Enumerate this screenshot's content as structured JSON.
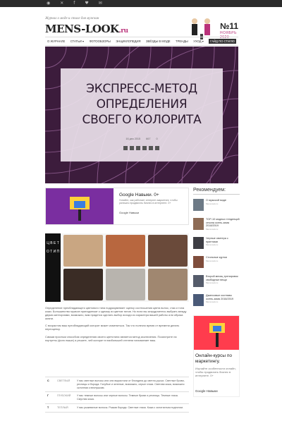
{
  "topbar": {
    "icons": [
      "rss-icon",
      "twitter-icon",
      "facebook-icon",
      "vk-icon",
      "mail-icon"
    ],
    "glyphs": [
      "◉",
      "✕",
      "f",
      "♥",
      "✉"
    ]
  },
  "header": {
    "tagline": "Журнал о моде и стиле для мужчин",
    "logo": "MENS-LOOK",
    "logo_suffix": ".ru",
    "issue_no": "№11",
    "issue_month": "НОЯБРЬ 2020"
  },
  "nav": {
    "items": [
      "О журнале",
      "Статьи ▾",
      "Фотообзоры",
      "Энциклопедия",
      "Звёзды в моде",
      "Тренды",
      "Уход ▾",
      "Гайд по стилю"
    ]
  },
  "hero": {
    "title_lines": [
      "ЭКСПРЕСС-МЕТОД",
      "ОПРЕДЕЛЕНИЯ",
      "СВОЕГО КОЛОРИТА"
    ],
    "date": "16 дек 2015",
    "views": "667",
    "comments": "0"
  },
  "ad": {
    "title": "Google Навыки. 0+",
    "desc": "Узнайте, как работает интернет-маркетинг, чтобы успешно продвигать бизнес в интернете. 0+",
    "source": "Google Навыки"
  },
  "sidebar": {
    "title": "Рекомендуем:",
    "items": [
      {
        "title": "О мужской моде",
        "meta": "Mens-look.ru"
      },
      {
        "title": "TOP-10 модных тенденций сезона осень-зима 2018/2019",
        "meta": "Mens-look.ru"
      },
      {
        "title": "Черные свитера с принтами",
        "meta": "Mens-look.ru"
      },
      {
        "title": "Стильные куртки",
        "meta": "Mens-look.ru"
      },
      {
        "title": "Второй месяц тренировок свободные вещи",
        "meta": "Mens-look.ru"
      },
      {
        "title": "Джинсовые костюмы осень-зима 2018/2019",
        "meta": "Mens-look.ru"
      }
    ],
    "ad_title": "Онлайн-курсы по маркетингу.",
    "ad_sub": "Изучайте особенности онлайн, чтобы продвигать бизнес в интернете. 0+",
    "ad_src": "Google Навыки"
  },
  "collage": {
    "side_text": "Ц В Е Т О Т И П"
  },
  "body": {
    "paragraphs": [
      "Определение преобладающего цветового типа подразумевает оценку соотношения цвета волос, глаз и тона кожи. Большинство мужчин принадлежат к одному из цветов типов. Но если вы затрудняетесь выбрать между двумя категориями, возможно, вам придется сделать выбор исходя из характера вашей работы или образа жизни.",
      "С возрастом ваш преобладающий колорит может измениться. Так что полезно время от времени делать переоценку.",
      "Самым простым способом определения своего цветотипа является метод исключения. Посмотрите на портреты (фото выше) и решите, чей колорит в наибольшей степени напоминает ваш."
    ]
  },
  "table": {
    "rows": [
      {
        "letter": "С",
        "name": "СВЕТЛЫЙ",
        "desc": "У вас светлые волосы или они вырастали от блондина до светло-русых. Светлые брови, ресницы и борода. Голубые и зеленые, возможно, серые глаза. Светлая кожа, возможно склонная к веснушкам."
      },
      {
        "letter": "Г",
        "name": "ГЛУБОКИЙ",
        "desc": "У вас темные волосы или черные волосы. Темные брови и ресницы. Темные глаза. Смуглая кожа."
      },
      {
        "letter": "Т",
        "name": "ТЕПЛЫЙ",
        "desc": "У вас рыжеватые волосы. Рыжая борода. Светлые глаза. Кожа с золотистым подтоном."
      }
    ]
  }
}
